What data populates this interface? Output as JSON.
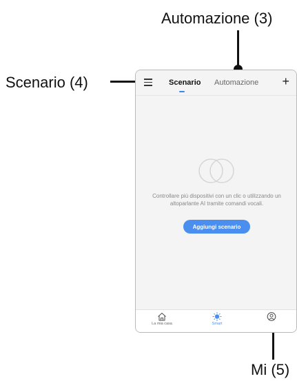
{
  "callouts": {
    "automazione": "Automazione (3)",
    "scenario": "Scenario (4)",
    "mi": "Mi (5)"
  },
  "header": {
    "tabs": [
      {
        "label": "Scenario",
        "active": true
      },
      {
        "label": "Automazione",
        "active": false
      }
    ],
    "menu_icon": "menu-icon",
    "add_icon": "plus-icon"
  },
  "main": {
    "empty_icon": "overlapping-circles-icon",
    "empty_text": "Controllare più dispositivi con un clic o utilizzando un altoparlante AI tramite comandi vocali.",
    "add_button_label": "Aggiungi scenario"
  },
  "bottom_nav": [
    {
      "label": "La mia casa",
      "icon": "home-icon"
    },
    {
      "label": "Smart",
      "icon": "sun-icon",
      "active": true
    },
    {
      "label": "",
      "icon": "profile-icon"
    }
  ],
  "colors": {
    "accent": "#4a8ff0",
    "background": "#f4f4f4"
  }
}
